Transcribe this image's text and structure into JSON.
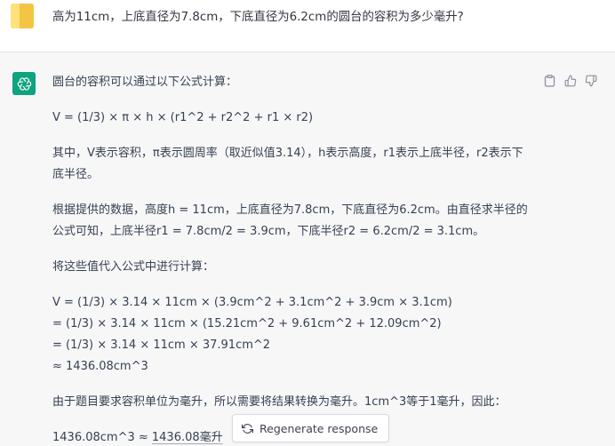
{
  "user_message": {
    "text": "高为11cm，上底直径为7.8cm，下底直径为6.2cm的圆台的容积为多少毫升?"
  },
  "assistant_message": {
    "intro": "圆台的容积可以通过以下公式计算：",
    "formula": "V = (1/3) × π × h × (r1^2 + r2^2 + r1 × r2)",
    "explanation": "其中，V表示容积，π表示圆周率（取近似值3.14），h表示高度，r1表示上底半径，r2表示下底半径。",
    "data_intro": "根据提供的数据，高度h = 11cm，上底直径为7.8cm，下底直径为6.2cm。由直径求半径的公式可知，上底半径r1 = 7.8cm/2 = 3.9cm，下底半径r2 = 6.2cm/2 = 3.1cm。",
    "calc_intro": "将这些值代入公式中进行计算：",
    "calc_lines": [
      "V = (1/3) × 3.14 × 11cm × (3.9cm^2 + 3.1cm^2 + 3.9cm × 3.1cm)",
      "= (1/3) × 3.14 × 11cm × (15.21cm^2 + 9.61cm^2 + 12.09cm^2)",
      "= (1/3) × 3.14 × 11cm × 37.91cm^2",
      "≈ 1436.08cm^3"
    ],
    "conversion": "由于题目要求容积单位为毫升，所以需要将结果转换为毫升。1cm^3等于1毫升，因此：",
    "result_prefix": "1436.08cm^3 ≈ ",
    "result_value": "1436.08毫升"
  },
  "actions": {
    "copy_icon": "clipboard-icon",
    "like_icon": "thumbs-up-icon",
    "dislike_icon": "thumbs-down-icon"
  },
  "regenerate_button": {
    "label": "Regenerate response",
    "icon": "refresh-icon"
  },
  "colors": {
    "assistant_bg": "#f7f7f8",
    "gpt_green": "#10a37f",
    "user_avatar": "#f4c542",
    "text": "#374151"
  }
}
